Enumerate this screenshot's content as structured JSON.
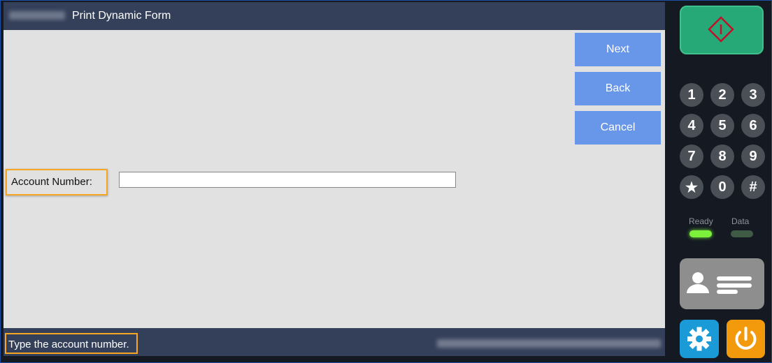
{
  "window": {
    "title": "Print Dynamic Form"
  },
  "actions": {
    "next_label": "Next",
    "back_label": "Back",
    "cancel_label": "Cancel"
  },
  "form": {
    "account_label": "Account Number:",
    "account_value": ""
  },
  "status": {
    "message": "Type the account number."
  },
  "keypad": {
    "keys": [
      "1",
      "2",
      "3",
      "4",
      "5",
      "6",
      "7",
      "8",
      "9",
      "★",
      "0",
      "#"
    ]
  },
  "indicators": {
    "ready_label": "Ready",
    "data_label": "Data",
    "ready_color": "#7cf03a",
    "data_color": "#3f5a45"
  },
  "colors": {
    "titlebar": "#34405a",
    "button": "#6897ea",
    "start": "#27a977",
    "settings": "#1a9ad6",
    "power": "#f29a0c",
    "highlight": "#f5a623"
  }
}
